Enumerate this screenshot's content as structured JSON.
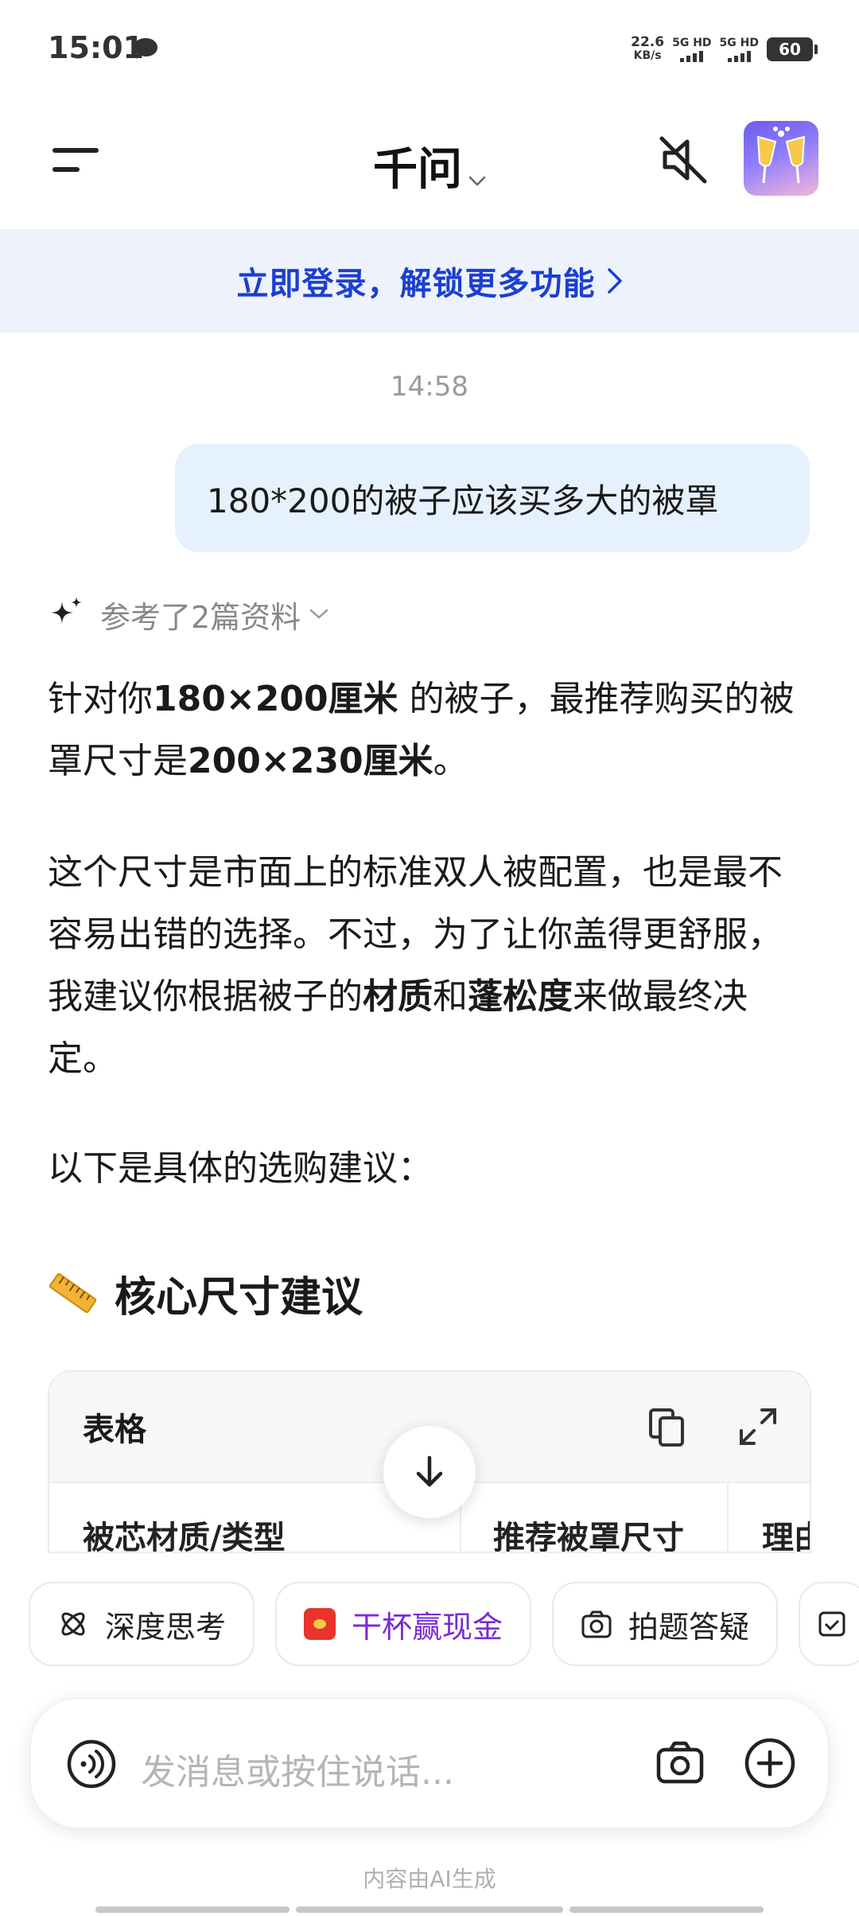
{
  "status_bar": {
    "time": "15:01",
    "net_speed_value": "22.6",
    "net_speed_unit": "KB/s",
    "sim1_label": "5G HD",
    "sim2_label": "5G HD",
    "battery": "60"
  },
  "header": {
    "title": "千问"
  },
  "banner": {
    "text": "立即登录，解锁更多功能"
  },
  "chat": {
    "timestamp": "14:58",
    "user_message": "180*200的被子应该买多大的被罩",
    "references": "参考了2篇资料",
    "p1_a": "针对你",
    "p1_b": "180×200厘米",
    "p1_c": " 的被子，最推荐购买的被罩尺寸是",
    "p1_d": "200×230厘米",
    "p1_e": "。",
    "p2_a": "这个尺寸是市面上的标准双人被配置，也是最不容易出错的选择。不过，为了让你盖得更舒服，我建议你根据被子的",
    "p2_b": "材质",
    "p2_c": "和",
    "p2_d": "蓬松度",
    "p2_e": "来做最终决定。",
    "p3": "以下是具体的选购建议：",
    "section_title": "核心尺寸建议",
    "table": {
      "label": "表格",
      "columns": [
        "被芯材质/类型",
        "推荐被罩尺寸",
        "理由"
      ]
    }
  },
  "chips": [
    {
      "label": "深度思考"
    },
    {
      "label": "干杯赢现金"
    },
    {
      "label": "拍题答疑"
    }
  ],
  "input": {
    "placeholder": "发消息或按住说话..."
  },
  "footer": {
    "note": "内容由AI生成"
  }
}
